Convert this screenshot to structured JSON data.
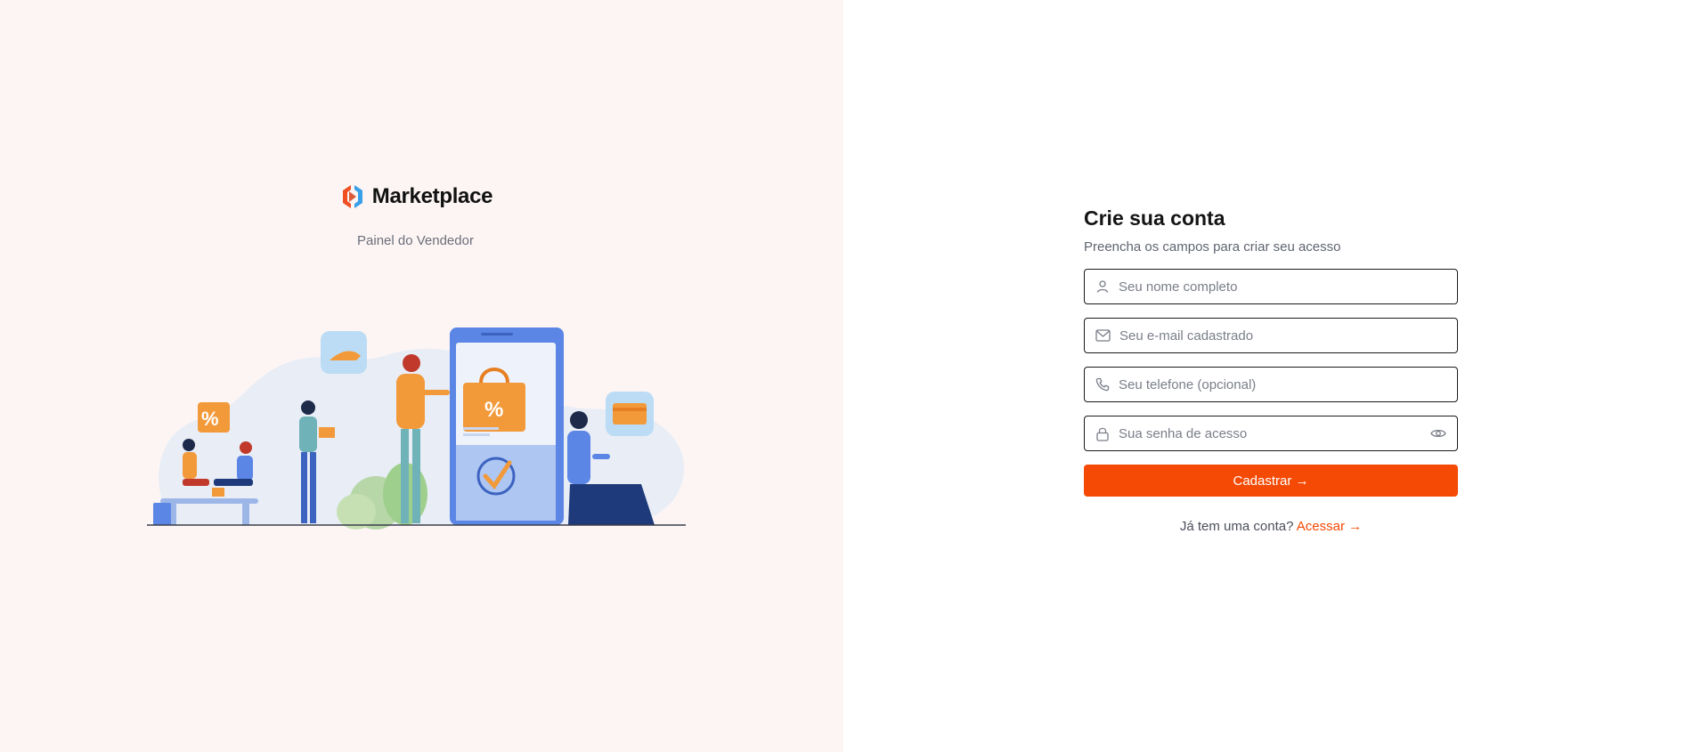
{
  "brand": {
    "name": "Marketplace",
    "subtitle": "Painel do Vendedor",
    "logo_icon": "marketplace-logo-icon",
    "colors": {
      "logo_orange": "#f04e23",
      "logo_blue": "#3aa0e8"
    }
  },
  "illustration": {
    "icon": "shopping-people-illustration"
  },
  "form": {
    "title": "Crie sua conta",
    "subtitle": "Preencha os campos para criar seu acesso",
    "fields": {
      "name": {
        "placeholder": "Seu nome completo",
        "value": "",
        "icon": "user-icon"
      },
      "email": {
        "placeholder": "Seu e-mail cadastrado",
        "value": "",
        "icon": "mail-icon"
      },
      "phone": {
        "placeholder": "Seu telefone (opcional)",
        "value": "",
        "icon": "phone-icon"
      },
      "password": {
        "placeholder": "Sua senha de acesso",
        "value": "",
        "icon": "lock-icon",
        "toggle_icon": "eye-icon"
      }
    },
    "submit_label": "Cadastrar →",
    "login_prompt": "Já tem uma conta?",
    "login_link": "Acessar →"
  },
  "colors": {
    "accent": "#f54a05",
    "left_panel_bg": "#fdf5f4"
  }
}
